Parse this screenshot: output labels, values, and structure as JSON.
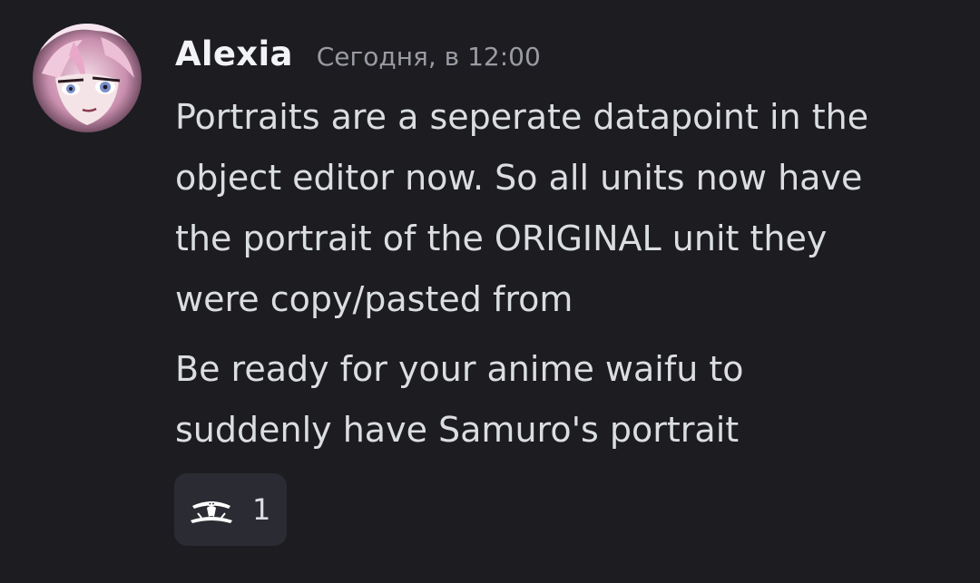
{
  "message": {
    "author": "Alexia",
    "timestamp": "Сегодня, в 12:00",
    "lines": [
      "Portraits are a seperate datapoint in the",
      "object editor now. So all units now have",
      "the portrait of the ORIGINAL unit they",
      "were copy/pasted from"
    ],
    "lines2": [
      "Be ready for your anime waifu to",
      "suddenly have Samuro's portrait"
    ]
  },
  "reaction": {
    "emoji_icon": "custom-ship-emoji",
    "count": "1"
  },
  "colors": {
    "background": "#1c1c21",
    "username": "#f2f3f5",
    "timestamp": "#9a9ba3",
    "text": "#dbdee1",
    "reaction_bg": "#2b2c33"
  }
}
